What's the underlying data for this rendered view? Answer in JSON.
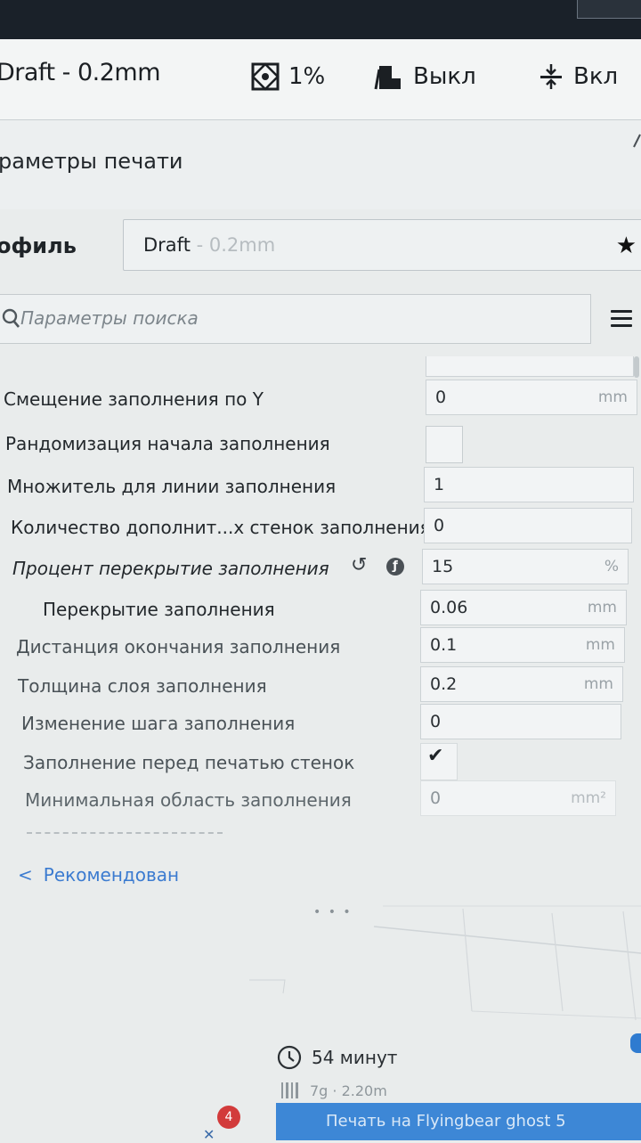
{
  "header": {
    "profile": "Draft - 0.2mm",
    "infill": "1%",
    "support": "Выкл",
    "adhesion": "Вкл"
  },
  "panel": {
    "title": "раметры печати"
  },
  "profile": {
    "label": "офиль",
    "name": "Draft",
    "sub": " - 0.2mm"
  },
  "search": {
    "placeholder": "Параметры поиска"
  },
  "settings": [
    {
      "label": "Смещение заполнения по Y",
      "value": "0",
      "unit": "mm"
    },
    {
      "label": "Рандомизация начала заполнения",
      "value": "",
      "unit": ""
    },
    {
      "label": "Множитель для линии заполнения",
      "value": "1",
      "unit": ""
    },
    {
      "label": "Количество дополнит...х стенок заполнения",
      "value": "0",
      "unit": ""
    },
    {
      "label": "Процент перекрытие заполнения",
      "value": "15",
      "unit": "%"
    },
    {
      "label": "Перекрытие заполнения",
      "value": "0.06",
      "unit": "mm"
    },
    {
      "label": "Дистанция окончания заполнения",
      "value": "0.1",
      "unit": "mm"
    },
    {
      "label": "Толщина слоя заполнения",
      "value": "0.2",
      "unit": "mm"
    },
    {
      "label": "Изменение шага заполнения",
      "value": "0",
      "unit": ""
    },
    {
      "label": "Заполнение перед печатью стенок",
      "value": "",
      "unit": ""
    },
    {
      "label": "Минимальная область заполнения",
      "value": "0",
      "unit": "mm²"
    }
  ],
  "recommended": "Рекомендован",
  "estimate": {
    "time": "54 минут",
    "material": "7g · 2.20m"
  },
  "badge": "4",
  "print_button": "Печать на Flyingbear ghost 5",
  "colors": {
    "accent": "#3d87d6",
    "badge": "#d23b3b",
    "link": "#3b7bd0"
  }
}
